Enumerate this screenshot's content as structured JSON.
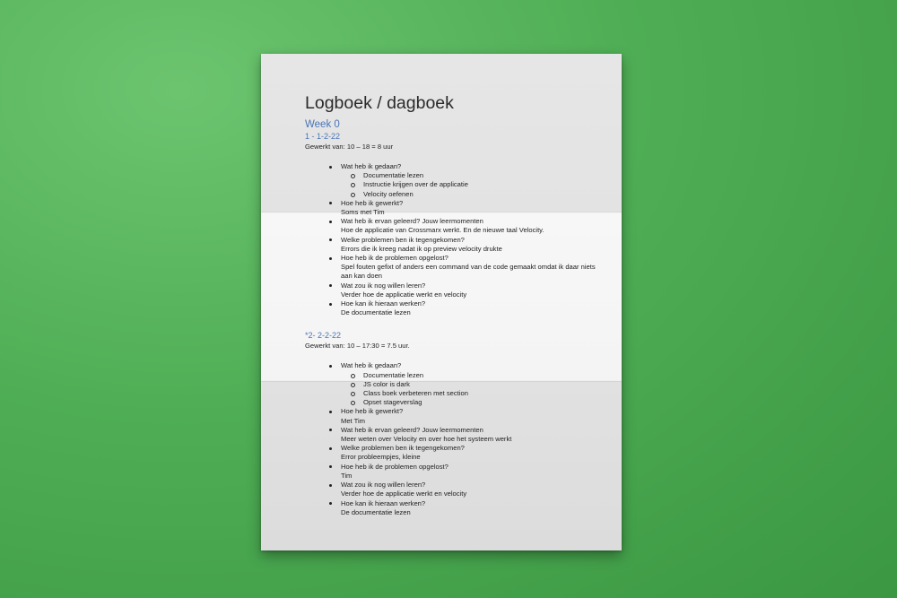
{
  "doc": {
    "title": "Logboek / dagboek",
    "week": "Week 0",
    "days": [
      {
        "date": "1 - 1-2-22",
        "worked": "Gewerkt van: 10 – 18 = 8 uur",
        "items": [
          {
            "q": "Wat heb ik gedaan?",
            "a": "",
            "sub": [
              "Documentatie lezen",
              "Instructie krijgen over de applicatie",
              "Velocity oefenen"
            ]
          },
          {
            "q": "Hoe heb ik gewerkt?",
            "a": "Soms met Tim"
          },
          {
            "q": "Wat heb ik ervan geleerd? Jouw leermomenten",
            "a": "Hoe de applicatie van Crossmarx werkt. En de nieuwe taal Velocity."
          },
          {
            "q": "Welke problemen ben ik tegengekomen?",
            "a": "Errors die ik kreeg nadat ik op preview velocity drukte"
          },
          {
            "q": "Hoe heb ik de problemen opgelost?",
            "a": "Spel fouten gefixt of anders een command van de code gemaakt omdat ik daar niets aan kan doen"
          },
          {
            "q": "Wat zou ik nog willen leren?",
            "a": "Verder hoe de applicatie werkt en velocity"
          },
          {
            "q": "Hoe kan ik hieraan werken?",
            "a": "De documentatie lezen"
          }
        ]
      },
      {
        "date": "*2- 2-2-22",
        "worked": "Gewerkt van: 10 – 17:30 = 7.5 uur.",
        "items": [
          {
            "q": "Wat heb ik gedaan?",
            "a": "",
            "sub": [
              "Documentatie lezen",
              "JS color is dark",
              "Class boek verbeteren met section",
              "Opset stageverslag"
            ]
          },
          {
            "q": "Hoe heb ik gewerkt?",
            "a": "Met Tim"
          },
          {
            "q": "Wat heb ik ervan geleerd? Jouw leermomenten",
            "a": "Meer weten over Velocity en over hoe het systeem werkt"
          },
          {
            "q": "Welke problemen ben ik tegengekomen?",
            "a": "Error probleempjes, kleine"
          },
          {
            "q": "Hoe heb ik de problemen opgelost?",
            "a": "Tim"
          },
          {
            "q": "Wat zou ik nog willen leren?",
            "a": "Verder hoe de applicatie werkt en velocity"
          },
          {
            "q": "Hoe kan ik hieraan werken?",
            "a": "De documentatie lezen"
          }
        ]
      }
    ]
  }
}
